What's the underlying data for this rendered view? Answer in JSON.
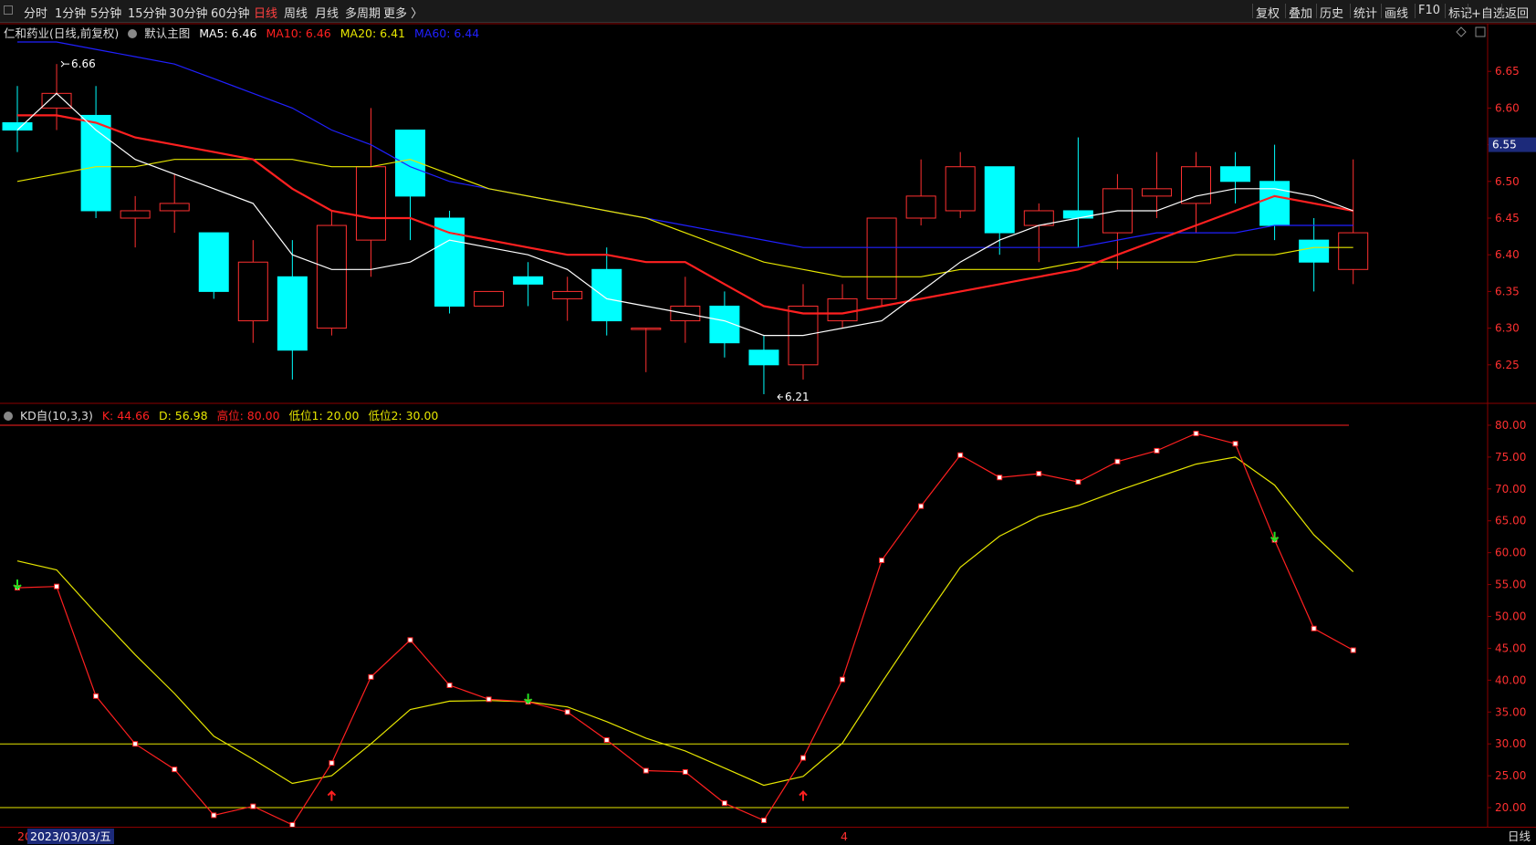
{
  "toolbar": {
    "left": [
      "分时",
      "1分钟",
      "5分钟",
      "15分钟",
      "30分钟",
      "60分钟",
      "日线",
      "周线",
      "月线",
      "多周期",
      "更多 〉"
    ],
    "active": "日线",
    "right": [
      "复权",
      "叠加",
      "历史",
      "统计",
      "画线",
      "F10",
      "标记",
      "+自选",
      "返回"
    ]
  },
  "main_info": {
    "stock": "仁和药业(日线,前复权)",
    "template": "默认主图",
    "ma5": "MA5: 6.46",
    "ma10": "MA10: 6.46",
    "ma20": "MA20: 6.41",
    "ma60": "MA60: 6.44"
  },
  "sub_info": {
    "name": "KD自(10,3,3)",
    "k": "K: 44.66",
    "d": "D: 56.98",
    "high": "高位: 80.00",
    "low1": "低位1: 20.00",
    "low2": "低位2: 30.00"
  },
  "bottom": {
    "prefix": "20",
    "date": "2023/03/03/五",
    "tick": "4",
    "period": "日线"
  },
  "colors": {
    "up": "#ff3030",
    "down": "#00ffff",
    "ma5": "#ffffff",
    "ma10": "#ff2020",
    "ma20": "#e6e600",
    "ma60": "#2020ff",
    "k": "#ff2020",
    "d": "#e6e600"
  },
  "chart_data": [
    {
      "type": "candlestick",
      "title": "仁和药业(日线,前复权)",
      "ylim": [
        6.2,
        6.7
      ],
      "yticks": [
        6.25,
        6.3,
        6.35,
        6.4,
        6.45,
        6.5,
        6.55,
        6.6,
        6.65
      ],
      "current_price": 6.55,
      "max_label": "6.66",
      "min_label": "6.21",
      "max_index": 1,
      "min_index": 19,
      "candles": [
        {
          "o": 6.58,
          "h": 6.63,
          "l": 6.54,
          "c": 6.57
        },
        {
          "o": 6.6,
          "h": 6.66,
          "l": 6.57,
          "c": 6.62
        },
        {
          "o": 6.59,
          "h": 6.63,
          "l": 6.45,
          "c": 6.46
        },
        {
          "o": 6.45,
          "h": 6.48,
          "l": 6.41,
          "c": 6.46
        },
        {
          "o": 6.46,
          "h": 6.51,
          "l": 6.43,
          "c": 6.47
        },
        {
          "o": 6.43,
          "h": 6.43,
          "l": 6.34,
          "c": 6.35
        },
        {
          "o": 6.31,
          "h": 6.42,
          "l": 6.28,
          "c": 6.39
        },
        {
          "o": 6.37,
          "h": 6.42,
          "l": 6.23,
          "c": 6.27
        },
        {
          "o": 6.3,
          "h": 6.46,
          "l": 6.29,
          "c": 6.44
        },
        {
          "o": 6.42,
          "h": 6.6,
          "l": 6.37,
          "c": 6.52
        },
        {
          "o": 6.57,
          "h": 6.57,
          "l": 6.42,
          "c": 6.48
        },
        {
          "o": 6.45,
          "h": 6.46,
          "l": 6.32,
          "c": 6.33
        },
        {
          "o": 6.33,
          "h": 6.35,
          "l": 6.33,
          "c": 6.35
        },
        {
          "o": 6.37,
          "h": 6.39,
          "l": 6.33,
          "c": 6.36
        },
        {
          "o": 6.34,
          "h": 6.37,
          "l": 6.31,
          "c": 6.35
        },
        {
          "o": 6.38,
          "h": 6.41,
          "l": 6.29,
          "c": 6.31
        },
        {
          "o": 6.3,
          "h": 6.3,
          "l": 6.24,
          "c": 6.3
        },
        {
          "o": 6.31,
          "h": 6.37,
          "l": 6.28,
          "c": 6.33
        },
        {
          "o": 6.33,
          "h": 6.35,
          "l": 6.26,
          "c": 6.28
        },
        {
          "o": 6.27,
          "h": 6.29,
          "l": 6.21,
          "c": 6.25
        },
        {
          "o": 6.25,
          "h": 6.36,
          "l": 6.23,
          "c": 6.33
        },
        {
          "o": 6.31,
          "h": 6.36,
          "l": 6.3,
          "c": 6.34
        },
        {
          "o": 6.34,
          "h": 6.45,
          "l": 6.33,
          "c": 6.45
        },
        {
          "o": 6.45,
          "h": 6.53,
          "l": 6.44,
          "c": 6.48
        },
        {
          "o": 6.46,
          "h": 6.54,
          "l": 6.45,
          "c": 6.52
        },
        {
          "o": 6.52,
          "h": 6.52,
          "l": 6.4,
          "c": 6.43
        },
        {
          "o": 6.44,
          "h": 6.47,
          "l": 6.39,
          "c": 6.46
        },
        {
          "o": 6.46,
          "h": 6.56,
          "l": 6.41,
          "c": 6.45
        },
        {
          "o": 6.43,
          "h": 6.51,
          "l": 6.38,
          "c": 6.49
        },
        {
          "o": 6.48,
          "h": 6.54,
          "l": 6.45,
          "c": 6.49
        },
        {
          "o": 6.47,
          "h": 6.54,
          "l": 6.43,
          "c": 6.52
        },
        {
          "o": 6.52,
          "h": 6.54,
          "l": 6.47,
          "c": 6.5
        },
        {
          "o": 6.5,
          "h": 6.55,
          "l": 6.42,
          "c": 6.44
        },
        {
          "o": 6.42,
          "h": 6.45,
          "l": 6.35,
          "c": 6.39
        },
        {
          "o": 6.38,
          "h": 6.53,
          "l": 6.36,
          "c": 6.43
        }
      ],
      "ma5": [
        6.57,
        6.62,
        6.57,
        6.53,
        6.51,
        6.49,
        6.47,
        6.4,
        6.38,
        6.38,
        6.39,
        6.42,
        6.41,
        6.4,
        6.38,
        6.34,
        6.33,
        6.32,
        6.31,
        6.29,
        6.29,
        6.3,
        6.31,
        6.35,
        6.39,
        6.42,
        6.44,
        6.45,
        6.46,
        6.46,
        6.48,
        6.49,
        6.49,
        6.48,
        6.46
      ],
      "ma10": [
        6.59,
        6.59,
        6.58,
        6.56,
        6.55,
        6.54,
        6.53,
        6.49,
        6.46,
        6.45,
        6.45,
        6.43,
        6.42,
        6.41,
        6.4,
        6.4,
        6.39,
        6.39,
        6.36,
        6.33,
        6.32,
        6.32,
        6.33,
        6.34,
        6.35,
        6.36,
        6.37,
        6.38,
        6.4,
        6.42,
        6.44,
        6.46,
        6.48,
        6.47,
        6.46
      ],
      "ma20": [
        6.5,
        6.51,
        6.52,
        6.52,
        6.53,
        6.53,
        6.53,
        6.53,
        6.52,
        6.52,
        6.53,
        6.51,
        6.49,
        6.48,
        6.47,
        6.46,
        6.45,
        6.43,
        6.41,
        6.39,
        6.38,
        6.37,
        6.37,
        6.37,
        6.38,
        6.38,
        6.38,
        6.39,
        6.39,
        6.39,
        6.39,
        6.4,
        6.4,
        6.41,
        6.41
      ],
      "ma60": [
        6.69,
        6.69,
        6.68,
        6.67,
        6.66,
        6.64,
        6.62,
        6.6,
        6.57,
        6.55,
        6.52,
        6.5,
        6.49,
        6.48,
        6.47,
        6.46,
        6.45,
        6.44,
        6.43,
        6.42,
        6.41,
        6.41,
        6.41,
        6.41,
        6.41,
        6.41,
        6.41,
        6.41,
        6.42,
        6.43,
        6.43,
        6.43,
        6.44,
        6.44,
        6.44
      ]
    },
    {
      "type": "line",
      "title": "KD自(10,3,3)",
      "ylim": [
        17,
        82
      ],
      "yticks": [
        20,
        25,
        30,
        35,
        40,
        45,
        50,
        55,
        60,
        65,
        70,
        75,
        80
      ],
      "reference_lines": [
        80,
        30,
        20
      ],
      "series": [
        {
          "name": "K",
          "values": [
            54.5,
            54.7,
            37.5,
            30.0,
            26.0,
            18.8,
            20.2,
            17.3,
            27.0,
            40.5,
            46.3,
            39.2,
            37.0,
            36.6,
            35.0,
            30.6,
            25.8,
            25.6,
            20.7,
            18.0,
            27.8,
            40.1,
            58.8,
            67.3,
            75.3,
            71.8,
            72.4,
            71.1,
            74.3,
            76.0,
            78.7,
            77.1,
            62.0,
            48.1,
            44.7
          ]
        },
        {
          "name": "D",
          "values": [
            58.7,
            57.3,
            50.5,
            44.0,
            37.9,
            31.2,
            27.6,
            23.8,
            25.0,
            30.0,
            35.4,
            36.7,
            36.8,
            36.6,
            35.8,
            33.5,
            30.9,
            28.9,
            26.2,
            23.5,
            24.9,
            30.1,
            39.6,
            48.8,
            57.7,
            62.6,
            65.7,
            67.4,
            69.7,
            71.8,
            73.9,
            75.0,
            70.6,
            62.8,
            57.0
          ]
        }
      ],
      "signals": [
        {
          "index": 0,
          "type": "down",
          "value": 54.5
        },
        {
          "index": 8,
          "type": "up",
          "value": 22.5
        },
        {
          "index": 13,
          "type": "down",
          "value": 36.6
        },
        {
          "index": 20,
          "type": "up",
          "value": 22.5
        },
        {
          "index": 32,
          "type": "down",
          "value": 62.0
        }
      ]
    }
  ]
}
